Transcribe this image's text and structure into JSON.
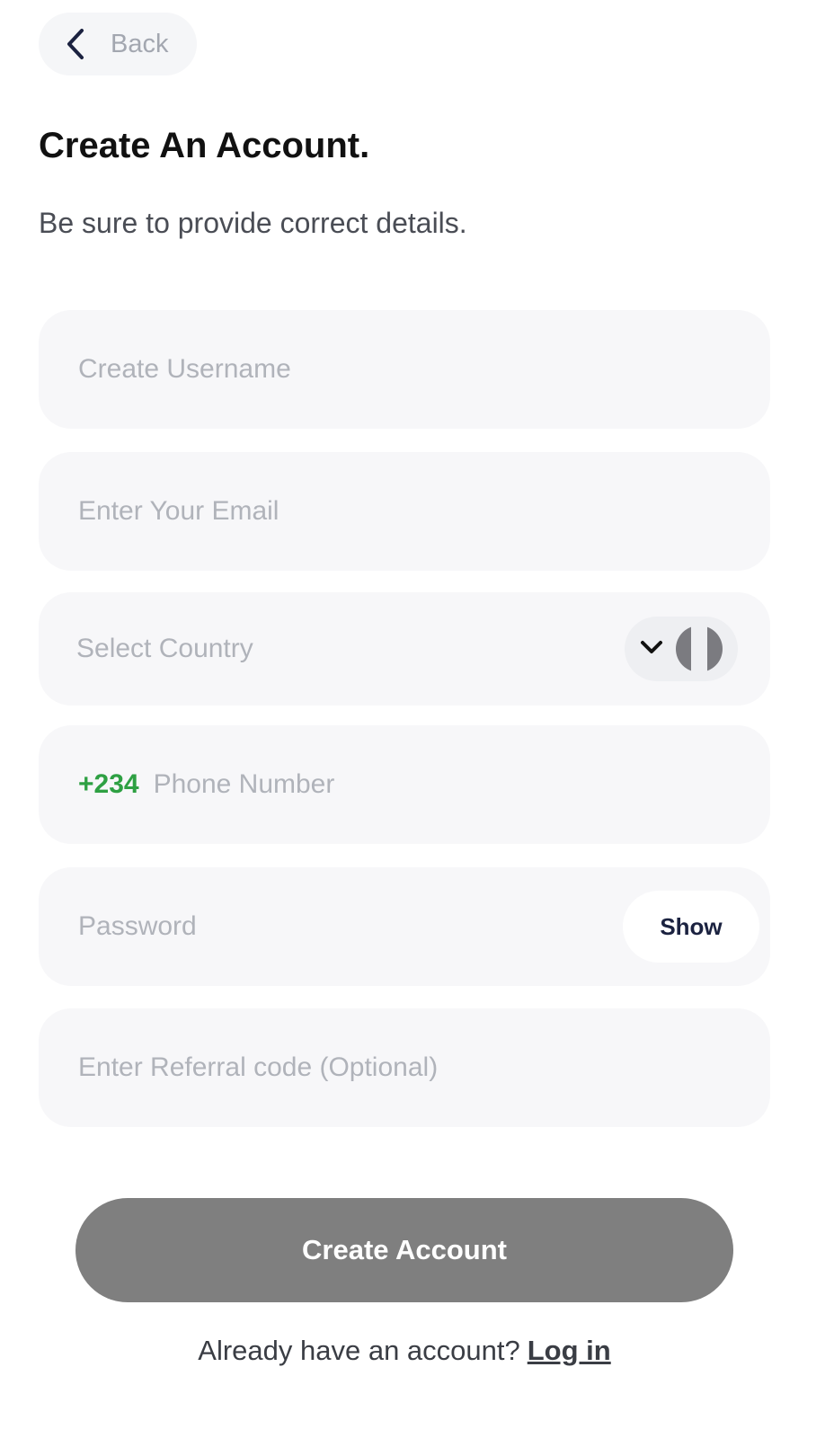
{
  "header": {
    "back_label": "Back"
  },
  "page": {
    "title": "Create An Account.",
    "subtitle": "Be sure to provide correct details."
  },
  "form": {
    "username": {
      "placeholder": "Create Username",
      "value": ""
    },
    "email": {
      "placeholder": "Enter Your Email",
      "value": ""
    },
    "country": {
      "placeholder": "Select Country",
      "flag_icon": "flag-icon",
      "dropdown_icon": "chevron-down-icon"
    },
    "phone": {
      "dial_code": "+234",
      "placeholder": "Phone Number",
      "value": ""
    },
    "password": {
      "placeholder": "Password",
      "value": "",
      "show_label": "Show"
    },
    "referral": {
      "placeholder": "Enter Referral code (Optional)",
      "value": ""
    }
  },
  "actions": {
    "create_account_label": "Create Account"
  },
  "footer": {
    "prompt": "Already have an account?",
    "login_label": "Log in"
  },
  "colors": {
    "accent_green": "#2ea043",
    "button_gray": "#7f7f7f",
    "field_bg": "#f7f7f9"
  }
}
